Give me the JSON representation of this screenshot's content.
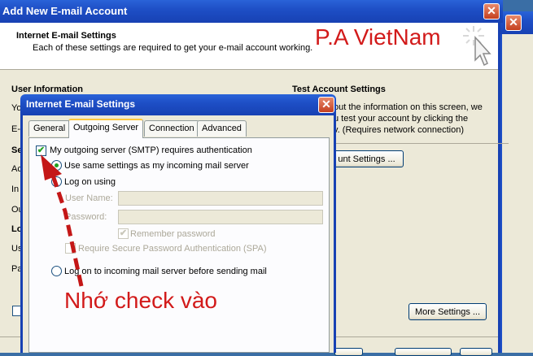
{
  "outer": {
    "title": "Add New E-mail Account",
    "header_title": "Internet E-mail Settings",
    "header_subtitle": "Each of these settings are required to get your e-mail account working.",
    "user_info_label": "User Information",
    "test_heading": "Test Account Settings",
    "test_text1": "out the information on this screen, we",
    "test_text2": "u test your account by clicking the",
    "test_text3": "v. (Requires network connection)",
    "test_button": "unt Settings ...",
    "more_settings": "More Settings ...",
    "left_fragments": [
      "Yo",
      "E-",
      "Se",
      "Ac",
      "In",
      "Ou",
      "Lo",
      "Us",
      "Pa"
    ]
  },
  "watermark": "P.A VietNam",
  "dialog": {
    "title": "Internet E-mail Settings",
    "tabs": [
      "General",
      "Outgoing Server",
      "Connection",
      "Advanced"
    ],
    "smtp_auth": "My outgoing server (SMTP) requires authentication",
    "use_same": "Use same settings as my incoming mail server",
    "log_on_using": "Log on using",
    "user_name_label": "User Name:",
    "password_label": "Password:",
    "remember": "Remember password",
    "spa": "Require Secure Password Authentication (SPA)",
    "log_on_incoming": "Log on to incoming mail server before sending mail"
  },
  "annotation": "Nhớ check vào",
  "colors": {
    "accent_red": "#d21a1a",
    "title_blue": "#1e4fc6"
  }
}
